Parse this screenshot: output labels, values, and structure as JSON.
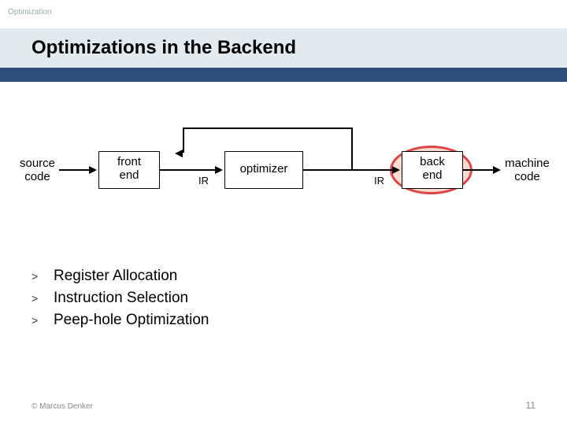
{
  "header": {
    "topic": "Optimization",
    "title": "Optimizations in the Backend"
  },
  "diagram": {
    "stages": {
      "source": {
        "l1": "source",
        "l2": "code"
      },
      "front": {
        "l1": "front",
        "l2": "end"
      },
      "opt": {
        "l1": "optimizer"
      },
      "back": {
        "l1": "back",
        "l2": "end"
      },
      "machine": {
        "l1": "machine",
        "l2": "code"
      }
    },
    "ir_label": "IR",
    "highlight": "back"
  },
  "bullets": {
    "marker": ">",
    "items": [
      "Register Allocation",
      "Instruction Selection",
      "Peep-hole Optimization"
    ]
  },
  "footer": {
    "copyright": "© Marcus Denker",
    "page": "11"
  },
  "chart_data": {
    "type": "diagram",
    "title": "Compiler pipeline with backend highlighted",
    "nodes": [
      {
        "id": "source",
        "label": "source code",
        "kind": "text"
      },
      {
        "id": "front",
        "label": "front end",
        "kind": "box"
      },
      {
        "id": "opt",
        "label": "optimizer",
        "kind": "box"
      },
      {
        "id": "back",
        "label": "back end",
        "kind": "box",
        "highlighted": true
      },
      {
        "id": "machine",
        "label": "machine code",
        "kind": "text"
      }
    ],
    "edges": [
      {
        "from": "source",
        "to": "front"
      },
      {
        "from": "front",
        "to": "opt",
        "label": "IR"
      },
      {
        "from": "opt",
        "to": "back",
        "label": "IR"
      },
      {
        "from": "back",
        "to": "machine"
      },
      {
        "from": "front",
        "to": "back",
        "kind": "bypass",
        "bidirectional": true
      }
    ]
  }
}
